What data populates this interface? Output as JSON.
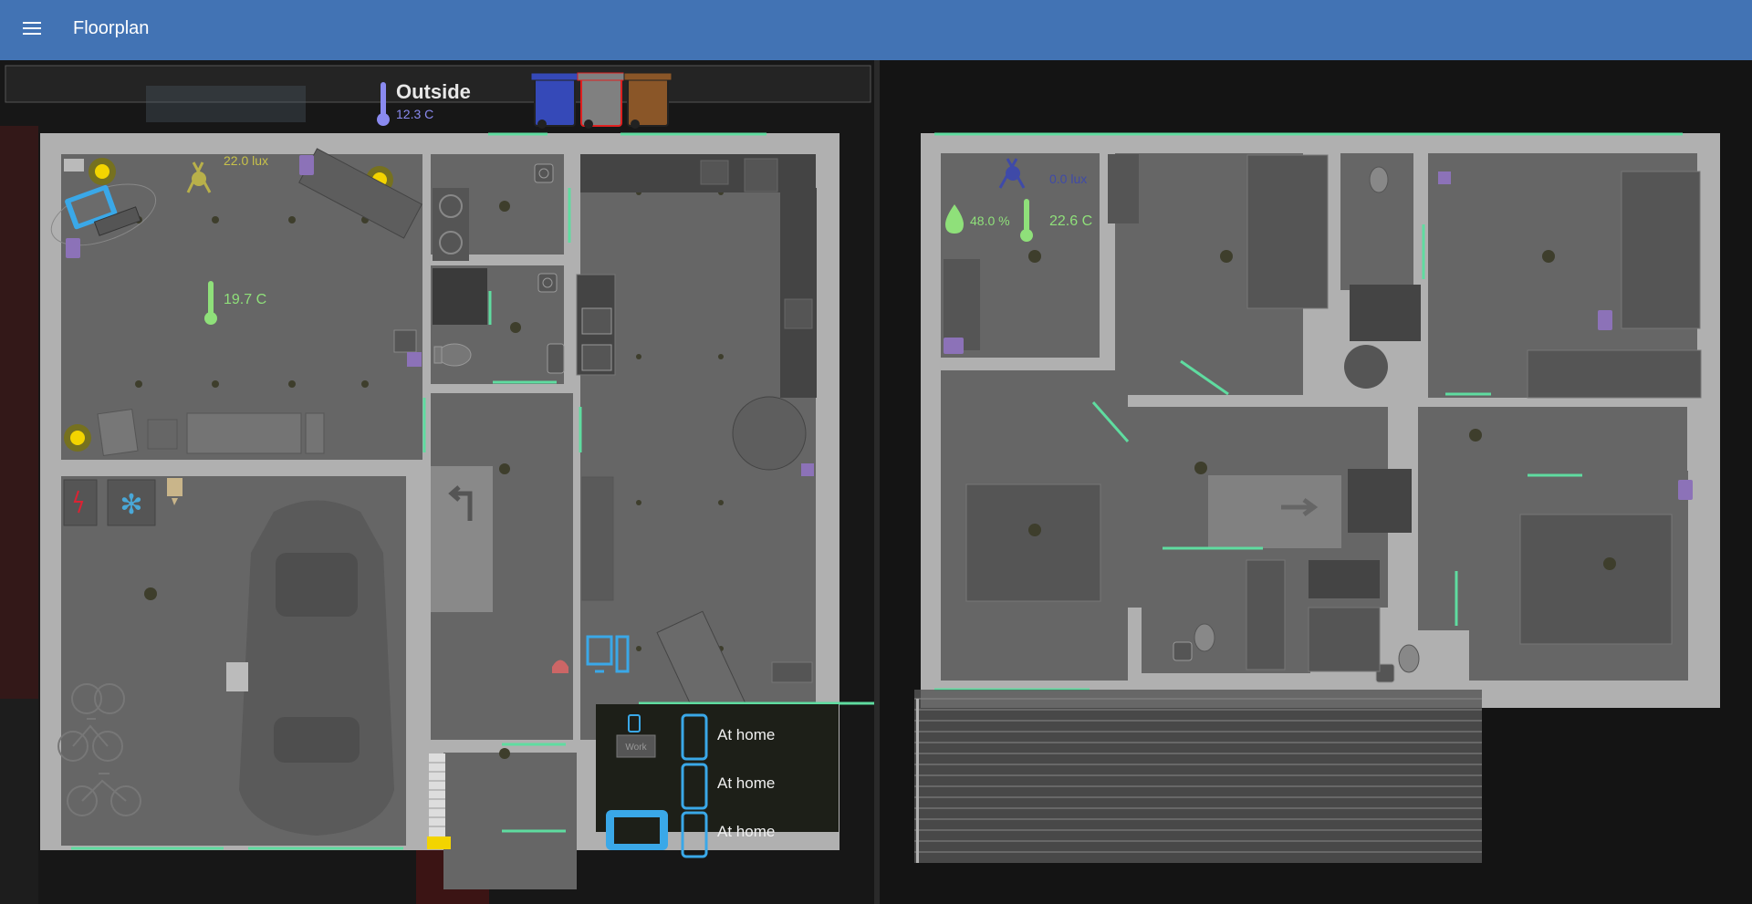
{
  "app": {
    "title": "Floorplan"
  },
  "outside": {
    "label": "Outside",
    "temperature": "12.3 C"
  },
  "ground_floor": {
    "living_lux": "22.0 lux",
    "living_temperature": "19.7 C"
  },
  "upper_floor": {
    "lux": "0.0 lux",
    "humidity": "48.0 %",
    "temperature": "22.6 C"
  },
  "presence": {
    "work_label": "Work",
    "people": [
      {
        "status": "At home"
      },
      {
        "status": "At home"
      },
      {
        "status": "At home"
      }
    ]
  },
  "bins": [
    {
      "color": "#3549b8"
    },
    {
      "color": "#808080",
      "highlight": "#e02020"
    },
    {
      "color": "#8a5628"
    }
  ],
  "colors": {
    "header": "#4273b4",
    "floor": "#666666",
    "wall": "#b5b5b5",
    "window": "#5fdca0",
    "light_on": "#f3d400",
    "media": "#a07ad0",
    "device_active": "#3aa8e8",
    "sensor_temp": "#8fe07a",
    "sensor_lux": "#c8c24a",
    "sensor_night": "#3f4aa8"
  }
}
